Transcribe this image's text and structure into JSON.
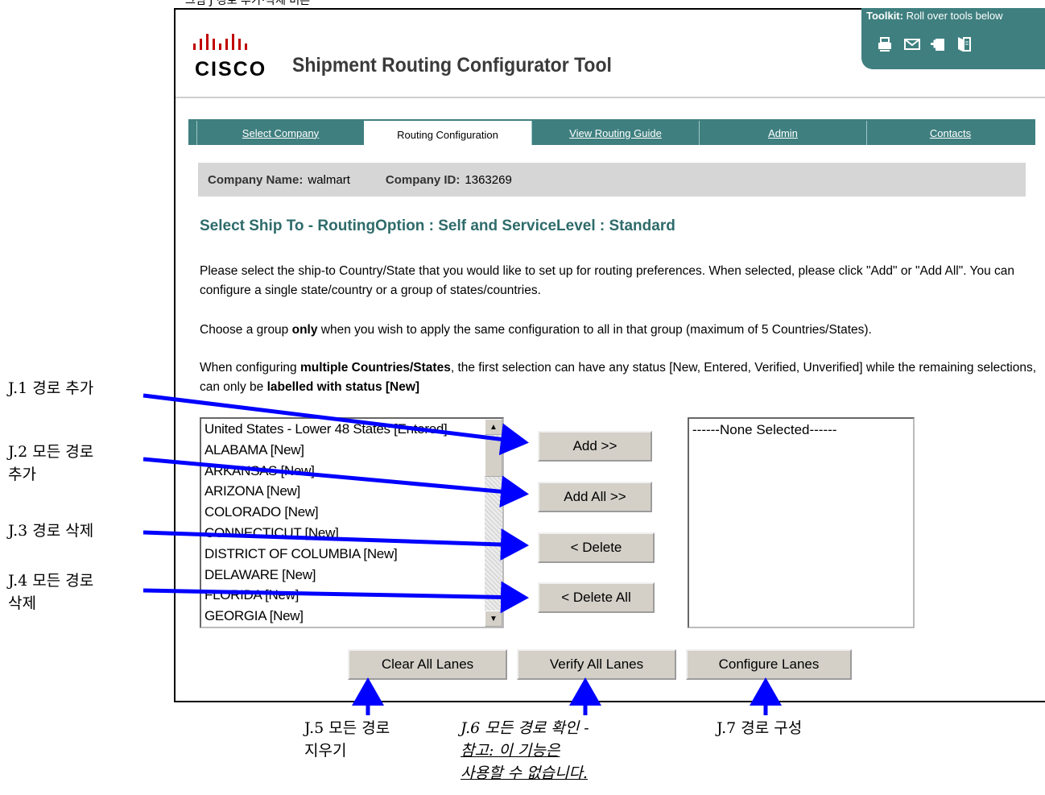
{
  "cropped_caption": "그림 J 경로 추가·삭제 버튼",
  "header": {
    "logo_text": "CISCO",
    "app_title": "Shipment Routing Configurator Tool",
    "toolkit_label_bold": "Toolkit:",
    "toolkit_label_rest": "Roll over tools below",
    "toolkit_icons": [
      "print-icon",
      "mail-icon",
      "add-bookmark-icon",
      "document-icon"
    ]
  },
  "tabs": [
    {
      "label": "Select Company",
      "active": false
    },
    {
      "label": "Routing Configuration",
      "active": true
    },
    {
      "label": "View Routing Guide",
      "active": false
    },
    {
      "label": "Admin",
      "active": false
    },
    {
      "label": "Contacts",
      "active": false
    }
  ],
  "company": {
    "name_label": "Company Name:",
    "name_value": "walmart",
    "id_label": "Company ID:",
    "id_value": "1363269"
  },
  "section_title": "Select Ship To - RoutingOption : Self and ServiceLevel : Standard",
  "instructions": {
    "p1": "Please select the ship-to Country/State that you would like to set up for routing preferences. When selected, please click \"Add\" or \"Add All\". You can configure a single state/country or a group of states/countries.",
    "p2_a": "Choose a group ",
    "p2_b": "only",
    "p2_c": " when you wish to apply the same configuration to all in that group (maximum of 5 Countries/States).",
    "p3_a": "When configuring ",
    "p3_b": "multiple Countries/States",
    "p3_c": ", the first selection can have any status [New, Entered, Verified, Unverified] while the remaining selections, can only be ",
    "p3_d": "labelled with status [New]"
  },
  "available_states": [
    "United States - Lower 48 States [Entered]",
    "ALABAMA [New]",
    "ARKANSAS [New]",
    "ARIZONA [New]",
    "COLORADO [New]",
    "CONNECTICUT [New]",
    "DISTRICT OF COLUMBIA [New]",
    "DELAWARE [New]",
    "FLORIDA [New]",
    "GEORGIA [New]"
  ],
  "selected_placeholder": "------None Selected------",
  "buttons": {
    "add": "Add >>",
    "add_all": "Add All >>",
    "delete": "< Delete",
    "delete_all": "< Delete All",
    "clear_all": "Clear All Lanes",
    "verify_all": "Verify All Lanes",
    "configure": "Configure Lanes"
  },
  "annotations": {
    "j1": "J.1 경로 추가",
    "j2_line1": "J.2 모든 경로",
    "j2_line2": "추가",
    "j3": "J.3 경로 삭제",
    "j4_line1": "J.4 모든 경로",
    "j4_line2": "삭제",
    "j5_line1": "J.5 모든 경로",
    "j5_line2": "지우기",
    "j6_line1": "J.6 모든 경로 확인 -",
    "j6_line2": "참고: 이 기능은",
    "j6_line3": "사용할 수 없습니다.",
    "j7": "J.7 경로 구성"
  },
  "colors": {
    "teal": "#3f7f7f",
    "title_teal": "#2f6b6b",
    "arrow_blue": "#0000ff",
    "company_bar": "#d6d6d6",
    "button_gray": "#d4d0c8"
  }
}
